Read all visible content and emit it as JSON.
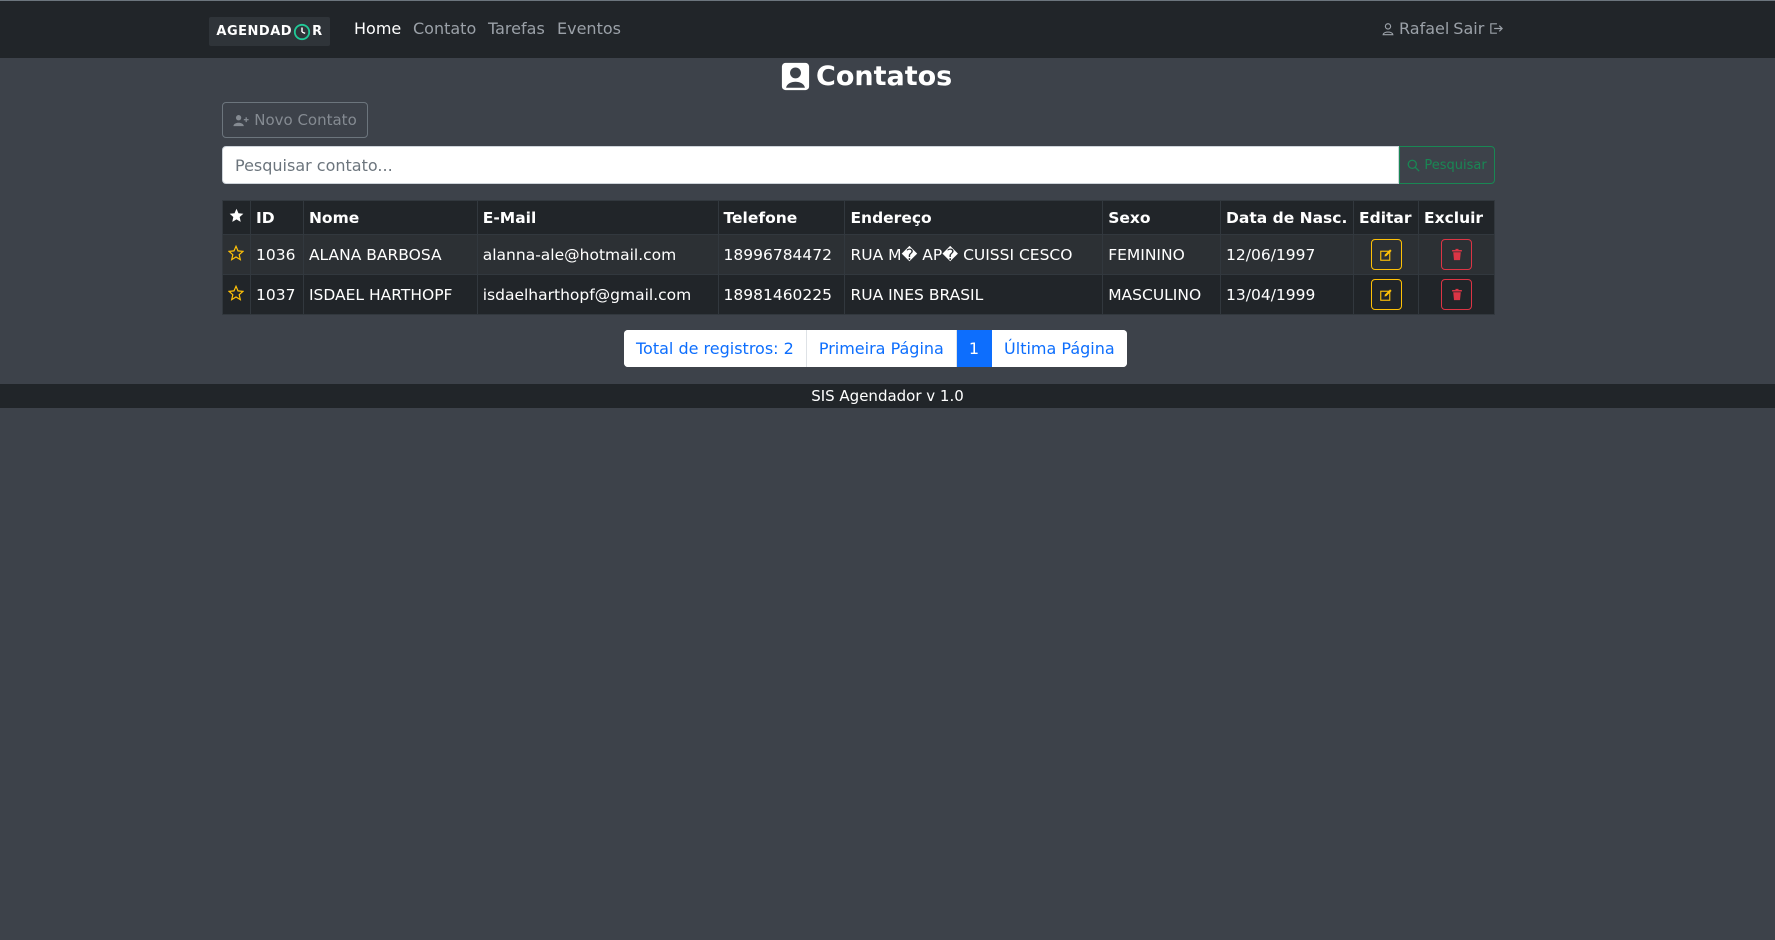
{
  "brand": {
    "text_left": "AGENDAD",
    "text_right": "R"
  },
  "nav": {
    "links": [
      {
        "label": "Home"
      },
      {
        "label": "Contato"
      },
      {
        "label": "Tarefas"
      },
      {
        "label": "Eventos"
      }
    ],
    "user_name": "Rafael",
    "logout_label": "Sair"
  },
  "page": {
    "title": "Contatos"
  },
  "actions": {
    "new_contact_label": "Novo Contato"
  },
  "search": {
    "placeholder": "Pesquisar contato...",
    "button_label": "Pesquisar"
  },
  "table": {
    "headers": [
      "ID",
      "Nome",
      "E-Mail",
      "Telefone",
      "Endereço",
      "Sexo",
      "Data de Nasc.",
      "Editar",
      "Excluir"
    ],
    "rows": [
      {
        "id": "1036",
        "nome": "ALANA BARBOSA",
        "email": "alanna-ale@hotmail.com",
        "telefone": "18996784472",
        "endereco": "RUA M� AP� CUISSI CESCO",
        "sexo": "FEMININO",
        "nascimento": "12/06/1997"
      },
      {
        "id": "1037",
        "nome": "ISDAEL HARTHOPF",
        "email": "isdaelharthopf@gmail.com",
        "telefone": "18981460225",
        "endereco": "RUA INES BRASIL",
        "sexo": "MASCULINO",
        "nascimento": "13/04/1999"
      }
    ]
  },
  "pagination": {
    "total_label": "Total de registros: 2",
    "first_label": "Primeira Página",
    "current_page": "1",
    "last_label": "Última Página"
  },
  "footer": {
    "text": "SIS Agendador v 1.0"
  },
  "colors": {
    "accent": "#0d6efd",
    "edit": "#ffc107",
    "delete": "#dc3545",
    "search": "#198754",
    "star": "#ffc107"
  }
}
